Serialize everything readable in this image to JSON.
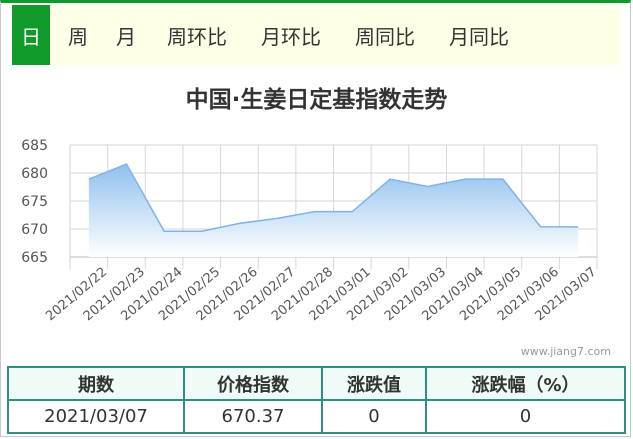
{
  "tabs": [
    {
      "label": "日",
      "active": true
    },
    {
      "label": "周",
      "active": false
    },
    {
      "label": "月",
      "active": false
    },
    {
      "label": "周环比",
      "active": false
    },
    {
      "label": "月环比",
      "active": false
    },
    {
      "label": "周同比",
      "active": false
    },
    {
      "label": "月同比",
      "active": false
    }
  ],
  "watermark": "www.jiang7.com",
  "chart_data": {
    "type": "area",
    "title": "中国·生姜日定基指数走势",
    "categories": [
      "2021/02/22",
      "2021/02/23",
      "2021/02/24",
      "2021/02/25",
      "2021/02/26",
      "2021/02/27",
      "2021/02/28",
      "2021/03/01",
      "2021/03/02",
      "2021/03/03",
      "2021/03/04",
      "2021/03/05",
      "2021/03/06",
      "2021/03/07"
    ],
    "values": [
      678.9,
      681.6,
      669.6,
      669.6,
      671.0,
      671.9,
      673.1,
      673.1,
      678.9,
      677.6,
      678.9,
      678.9,
      670.4,
      670.37
    ],
    "ylim": [
      665,
      685
    ],
    "yticks": [
      "665",
      "670",
      "675",
      "680",
      "685"
    ],
    "grid": true,
    "colors": {
      "line": "#7fb3e8",
      "fill_top": "#8fc0ee",
      "fill_bottom": "#ffffff"
    }
  },
  "table": {
    "headers": [
      "期数",
      "价格指数",
      "涨跌值",
      "涨跌幅（%）"
    ],
    "rows": [
      [
        "2021/03/07",
        "670.37",
        "0",
        "0"
      ]
    ]
  }
}
